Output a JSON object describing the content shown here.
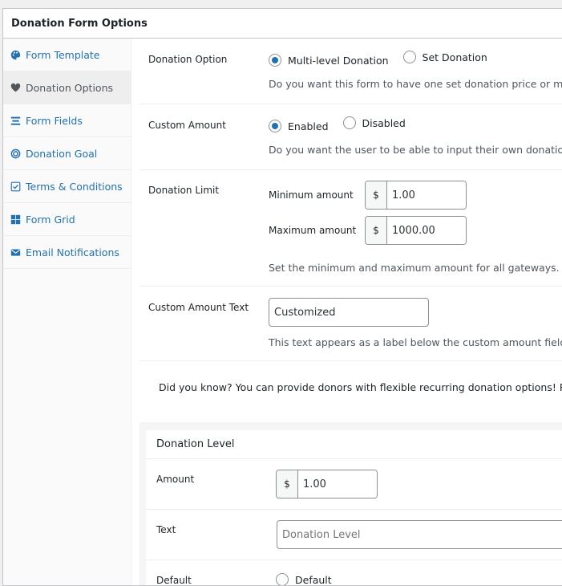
{
  "title": "Donation Form Options",
  "sidebar": {
    "items": [
      {
        "label": "Form Template",
        "icon": "palette-icon"
      },
      {
        "label": "Donation Options",
        "icon": "heart-icon",
        "active": true
      },
      {
        "label": "Form Fields",
        "icon": "list-icon"
      },
      {
        "label": "Donation Goal",
        "icon": "target-icon"
      },
      {
        "label": "Terms & Conditions",
        "icon": "checkbox-icon"
      },
      {
        "label": "Form Grid",
        "icon": "grid-icon"
      },
      {
        "label": "Email Notifications",
        "icon": "envelope-icon"
      }
    ]
  },
  "donation_option": {
    "label": "Donation Option",
    "options": [
      "Multi-level Donation",
      "Set Donation"
    ],
    "selected": "Multi-level Donation",
    "desc": "Do you want this form to have one set donation price or multiple levels"
  },
  "custom_amount": {
    "label": "Custom Amount",
    "options": [
      "Enabled",
      "Disabled"
    ],
    "selected": "Enabled",
    "desc": "Do you want the user to be able to input their own donation amount"
  },
  "donation_limit": {
    "label": "Donation Limit",
    "min_label": "Minimum amount",
    "min_value": "1.00",
    "max_label": "Maximum amount",
    "max_value": "1000.00",
    "currency": "$",
    "desc": "Set the minimum and maximum amount for all gateways."
  },
  "custom_amount_text": {
    "label": "Custom Amount Text",
    "value": "Customized",
    "desc": "This text appears as a label below the custom amount field for set donation forms"
  },
  "tip": {
    "text": "Did you know? You can provide donors with flexible recurring donation options! Recurring"
  },
  "level": {
    "title": "Donation Level",
    "amount_label": "Amount",
    "currency": "$",
    "amount_value": "1.00",
    "text_label": "Text",
    "text_placeholder": "Donation Level",
    "default_label": "Default",
    "default_option": "Default"
  },
  "colors": {
    "accent": "#2271b1"
  }
}
